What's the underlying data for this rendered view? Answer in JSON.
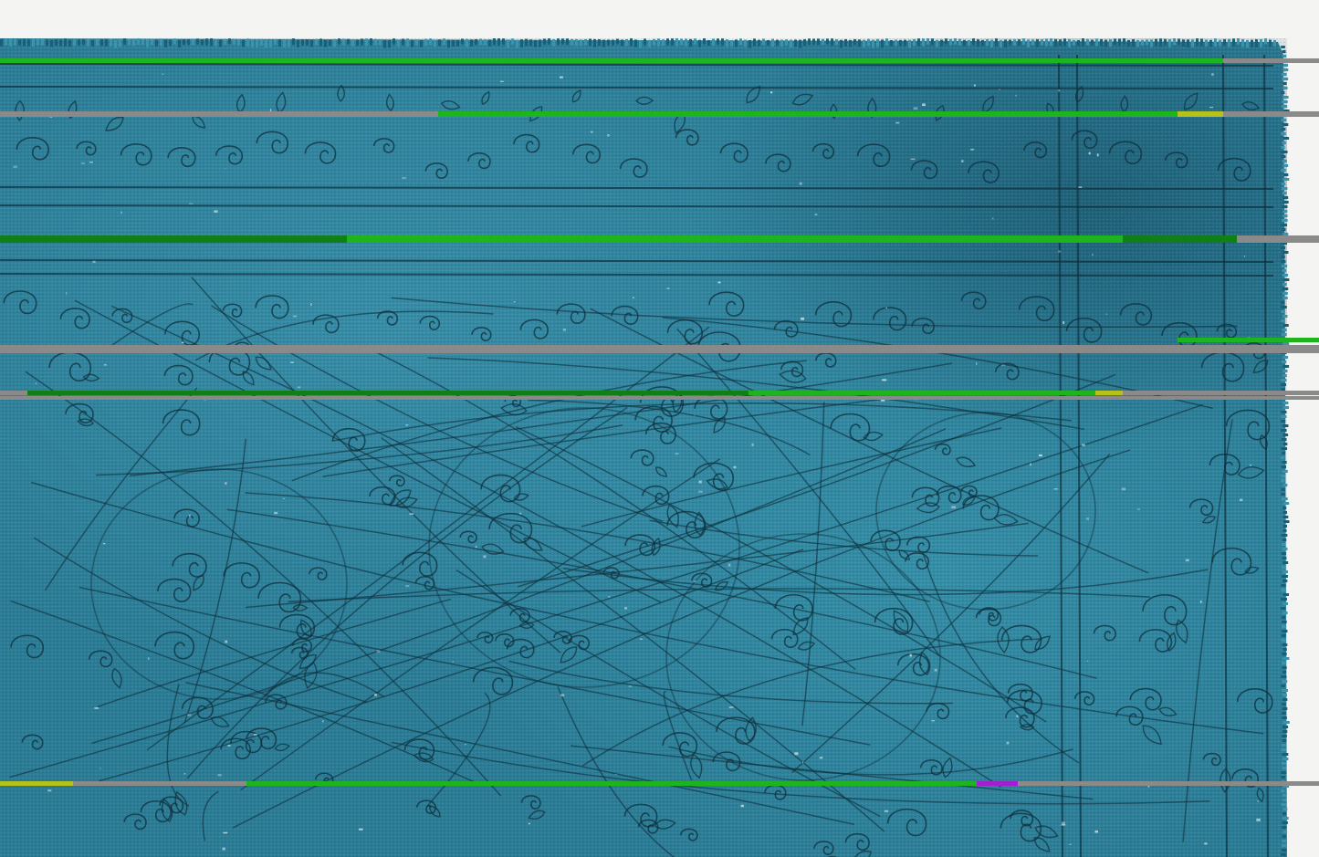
{
  "scene": {
    "subject": "overdyed-vintage-rug",
    "colors": {
      "backdrop": "#f4f4f2",
      "rug_base": "#2a7d97",
      "rug_light": "#3b93ad",
      "rug_dark": "#1b5f76",
      "rug_deep": "#0f3f52",
      "pattern_line": "#0d2f3c",
      "wear_highlight": "#cfe6ee",
      "artifact_green": "#1db41d",
      "artifact_green_dark": "#0f7f16",
      "artifact_gray": "#8a8a8a",
      "artifact_yellow": "#b6c21a",
      "artifact_purple": "#a020d0"
    }
  },
  "artifacts": {
    "scanline_count": 7,
    "scanline_colors": [
      "artifact_green",
      "artifact_gray",
      "artifact_green_dark",
      "artifact_purple",
      "artifact_yellow"
    ]
  }
}
